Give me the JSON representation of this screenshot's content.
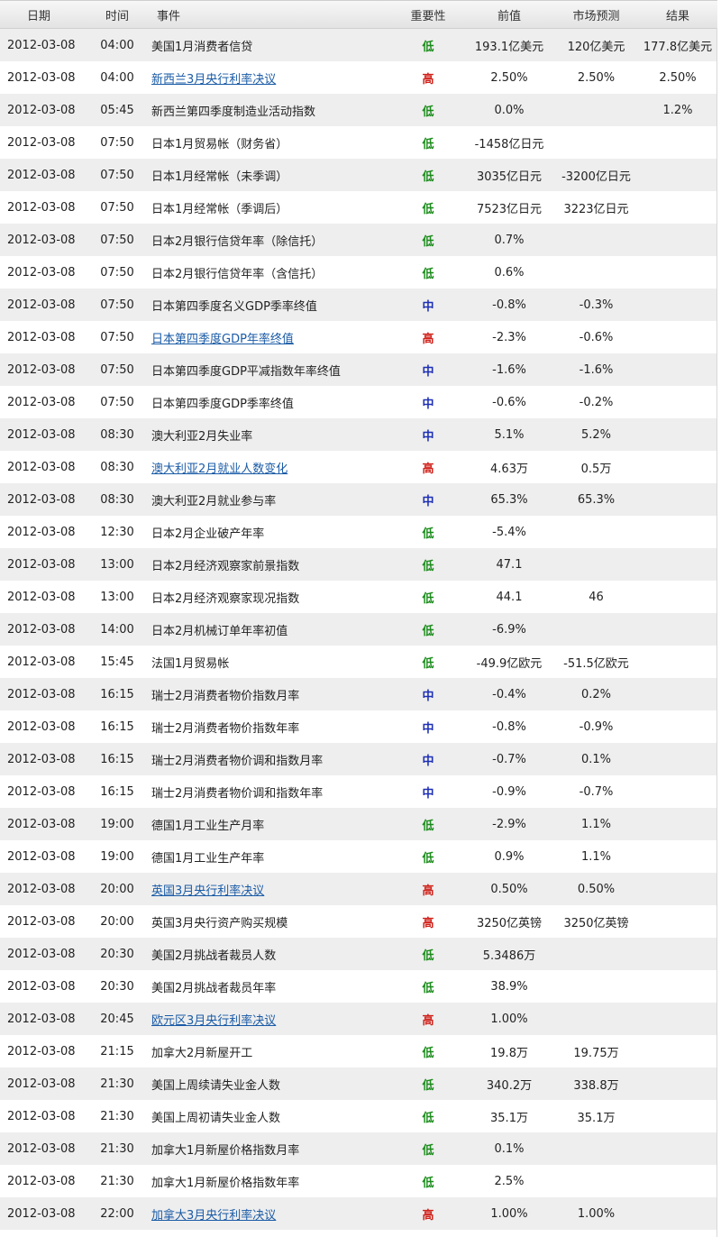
{
  "colors": {
    "low": "#1a8c1a",
    "high": "#d0221b",
    "mid": "#1d2fb5",
    "link": "#1a5ba6",
    "row_alt": "#eeeeee"
  },
  "header": {
    "date": "日期",
    "time": "时间",
    "event": "事件",
    "importance": "重要性",
    "previous": "前值",
    "forecast": "市场预测",
    "result": "结果"
  },
  "rows": [
    {
      "date": "2012-03-08",
      "time": "04:00",
      "event": "美国1月消费者信贷",
      "link": false,
      "importance": "低",
      "level": "low",
      "previous": "193.1亿美元",
      "forecast": "120亿美元",
      "result": "177.8亿美元"
    },
    {
      "date": "2012-03-08",
      "time": "04:00",
      "event": "新西兰3月央行利率决议",
      "link": true,
      "importance": "高",
      "level": "high",
      "previous": "2.50%",
      "forecast": "2.50%",
      "result": "2.50%"
    },
    {
      "date": "2012-03-08",
      "time": "05:45",
      "event": "新西兰第四季度制造业活动指数",
      "link": false,
      "importance": "低",
      "level": "low",
      "previous": "0.0%",
      "forecast": "",
      "result": "1.2%"
    },
    {
      "date": "2012-03-08",
      "time": "07:50",
      "event": "日本1月贸易帐（财务省）",
      "link": false,
      "importance": "低",
      "level": "low",
      "previous": "-1458亿日元",
      "forecast": "",
      "result": ""
    },
    {
      "date": "2012-03-08",
      "time": "07:50",
      "event": "日本1月经常帐（未季调）",
      "link": false,
      "importance": "低",
      "level": "low",
      "previous": "3035亿日元",
      "forecast": "-3200亿日元",
      "result": ""
    },
    {
      "date": "2012-03-08",
      "time": "07:50",
      "event": "日本1月经常帐（季调后）",
      "link": false,
      "importance": "低",
      "level": "low",
      "previous": "7523亿日元",
      "forecast": "3223亿日元",
      "result": ""
    },
    {
      "date": "2012-03-08",
      "time": "07:50",
      "event": "日本2月银行信贷年率（除信托）",
      "link": false,
      "importance": "低",
      "level": "low",
      "previous": "0.7%",
      "forecast": "",
      "result": ""
    },
    {
      "date": "2012-03-08",
      "time": "07:50",
      "event": "日本2月银行信贷年率（含信托）",
      "link": false,
      "importance": "低",
      "level": "low",
      "previous": "0.6%",
      "forecast": "",
      "result": ""
    },
    {
      "date": "2012-03-08",
      "time": "07:50",
      "event": "日本第四季度名义GDP季率终值",
      "link": false,
      "importance": "中",
      "level": "mid",
      "previous": "-0.8%",
      "forecast": "-0.3%",
      "result": ""
    },
    {
      "date": "2012-03-08",
      "time": "07:50",
      "event": "日本第四季度GDP年率终值",
      "link": true,
      "importance": "高",
      "level": "high",
      "previous": "-2.3%",
      "forecast": "-0.6%",
      "result": ""
    },
    {
      "date": "2012-03-08",
      "time": "07:50",
      "event": "日本第四季度GDP平减指数年率终值",
      "link": false,
      "importance": "中",
      "level": "mid",
      "previous": "-1.6%",
      "forecast": "-1.6%",
      "result": ""
    },
    {
      "date": "2012-03-08",
      "time": "07:50",
      "event": "日本第四季度GDP季率终值",
      "link": false,
      "importance": "中",
      "level": "mid",
      "previous": "-0.6%",
      "forecast": "-0.2%",
      "result": ""
    },
    {
      "date": "2012-03-08",
      "time": "08:30",
      "event": "澳大利亚2月失业率",
      "link": false,
      "importance": "中",
      "level": "mid",
      "previous": "5.1%",
      "forecast": "5.2%",
      "result": ""
    },
    {
      "date": "2012-03-08",
      "time": "08:30",
      "event": "澳大利亚2月就业人数变化",
      "link": true,
      "importance": "高",
      "level": "high",
      "previous": "4.63万",
      "forecast": "0.5万",
      "result": ""
    },
    {
      "date": "2012-03-08",
      "time": "08:30",
      "event": "澳大利亚2月就业参与率",
      "link": false,
      "importance": "中",
      "level": "mid",
      "previous": "65.3%",
      "forecast": "65.3%",
      "result": ""
    },
    {
      "date": "2012-03-08",
      "time": "12:30",
      "event": "日本2月企业破产年率",
      "link": false,
      "importance": "低",
      "level": "low",
      "previous": "-5.4%",
      "forecast": "",
      "result": ""
    },
    {
      "date": "2012-03-08",
      "time": "13:00",
      "event": "日本2月经济观察家前景指数",
      "link": false,
      "importance": "低",
      "level": "low",
      "previous": "47.1",
      "forecast": "",
      "result": ""
    },
    {
      "date": "2012-03-08",
      "time": "13:00",
      "event": "日本2月经济观察家现况指数",
      "link": false,
      "importance": "低",
      "level": "low",
      "previous": "44.1",
      "forecast": "46",
      "result": ""
    },
    {
      "date": "2012-03-08",
      "time": "14:00",
      "event": "日本2月机械订单年率初值",
      "link": false,
      "importance": "低",
      "level": "low",
      "previous": "-6.9%",
      "forecast": "",
      "result": ""
    },
    {
      "date": "2012-03-08",
      "time": "15:45",
      "event": "法国1月贸易帐",
      "link": false,
      "importance": "低",
      "level": "low",
      "previous": "-49.9亿欧元",
      "forecast": "-51.5亿欧元",
      "result": ""
    },
    {
      "date": "2012-03-08",
      "time": "16:15",
      "event": "瑞士2月消费者物价指数月率",
      "link": false,
      "importance": "中",
      "level": "mid",
      "previous": "-0.4%",
      "forecast": "0.2%",
      "result": ""
    },
    {
      "date": "2012-03-08",
      "time": "16:15",
      "event": "瑞士2月消费者物价指数年率",
      "link": false,
      "importance": "中",
      "level": "mid",
      "previous": "-0.8%",
      "forecast": "-0.9%",
      "result": ""
    },
    {
      "date": "2012-03-08",
      "time": "16:15",
      "event": "瑞士2月消费者物价调和指数月率",
      "link": false,
      "importance": "中",
      "level": "mid",
      "previous": "-0.7%",
      "forecast": "0.1%",
      "result": ""
    },
    {
      "date": "2012-03-08",
      "time": "16:15",
      "event": "瑞士2月消费者物价调和指数年率",
      "link": false,
      "importance": "中",
      "level": "mid",
      "previous": "-0.9%",
      "forecast": "-0.7%",
      "result": ""
    },
    {
      "date": "2012-03-08",
      "time": "19:00",
      "event": "德国1月工业生产月率",
      "link": false,
      "importance": "低",
      "level": "low",
      "previous": "-2.9%",
      "forecast": "1.1%",
      "result": ""
    },
    {
      "date": "2012-03-08",
      "time": "19:00",
      "event": "德国1月工业生产年率",
      "link": false,
      "importance": "低",
      "level": "low",
      "previous": "0.9%",
      "forecast": "1.1%",
      "result": ""
    },
    {
      "date": "2012-03-08",
      "time": "20:00",
      "event": "英国3月央行利率决议",
      "link": true,
      "importance": "高",
      "level": "high",
      "previous": "0.50%",
      "forecast": "0.50%",
      "result": ""
    },
    {
      "date": "2012-03-08",
      "time": "20:00",
      "event": "英国3月央行资产购买规模",
      "link": false,
      "importance": "高",
      "level": "high",
      "previous": "3250亿英镑",
      "forecast": "3250亿英镑",
      "result": ""
    },
    {
      "date": "2012-03-08",
      "time": "20:30",
      "event": "美国2月挑战者裁员人数",
      "link": false,
      "importance": "低",
      "level": "low",
      "previous": "5.3486万",
      "forecast": "",
      "result": ""
    },
    {
      "date": "2012-03-08",
      "time": "20:30",
      "event": "美国2月挑战者裁员年率",
      "link": false,
      "importance": "低",
      "level": "low",
      "previous": "38.9%",
      "forecast": "",
      "result": ""
    },
    {
      "date": "2012-03-08",
      "time": "20:45",
      "event": "欧元区3月央行利率决议",
      "link": true,
      "importance": "高",
      "level": "high",
      "previous": "1.00%",
      "forecast": "",
      "result": ""
    },
    {
      "date": "2012-03-08",
      "time": "21:15",
      "event": "加拿大2月新屋开工",
      "link": false,
      "importance": "低",
      "level": "low",
      "previous": "19.8万",
      "forecast": "19.75万",
      "result": ""
    },
    {
      "date": "2012-03-08",
      "time": "21:30",
      "event": "美国上周续请失业金人数",
      "link": false,
      "importance": "低",
      "level": "low",
      "previous": "340.2万",
      "forecast": "338.8万",
      "result": ""
    },
    {
      "date": "2012-03-08",
      "time": "21:30",
      "event": "美国上周初请失业金人数",
      "link": false,
      "importance": "低",
      "level": "low",
      "previous": "35.1万",
      "forecast": "35.1万",
      "result": ""
    },
    {
      "date": "2012-03-08",
      "time": "21:30",
      "event": "加拿大1月新屋价格指数月率",
      "link": false,
      "importance": "低",
      "level": "low",
      "previous": "0.1%",
      "forecast": "",
      "result": ""
    },
    {
      "date": "2012-03-08",
      "time": "21:30",
      "event": "加拿大1月新屋价格指数年率",
      "link": false,
      "importance": "低",
      "level": "low",
      "previous": "2.5%",
      "forecast": "",
      "result": ""
    },
    {
      "date": "2012-03-08",
      "time": "22:00",
      "event": "加拿大3月央行利率决议",
      "link": true,
      "importance": "高",
      "level": "high",
      "previous": "1.00%",
      "forecast": "1.00%",
      "result": ""
    }
  ]
}
